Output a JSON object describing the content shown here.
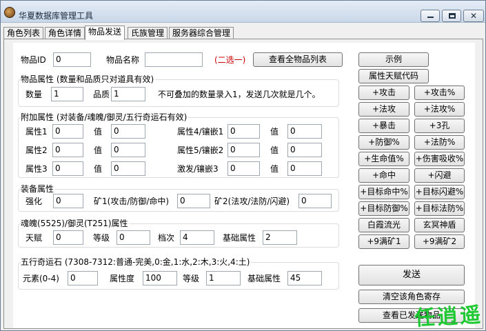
{
  "window": {
    "title": "华夏数据库管理工具",
    "close_glyph": "✕"
  },
  "tabs": [
    {
      "label": "角色列表",
      "active": false
    },
    {
      "label": "角色详情",
      "active": false
    },
    {
      "label": "物品发送",
      "active": true
    },
    {
      "label": "氏族管理",
      "active": false
    },
    {
      "label": "服务器综合管理",
      "active": false
    }
  ],
  "item": {
    "id_label": "物品ID",
    "id_value": "0",
    "name_label": "物品名称",
    "name_value": "",
    "choose_one": "(二选一)",
    "view_all_button": "查看全物品列表"
  },
  "item_attr": {
    "title": "物品属性 (数量和品质只对道具有效)",
    "qty_label": "数量",
    "qty_value": "1",
    "quality_label": "品质",
    "quality_value": "1",
    "note": "不可叠加的数量录入1，发送几次就是几个。"
  },
  "extra_attr": {
    "title": "附加属性 (对装备/魂魄/御灵/五行奇运石有效)",
    "value_label": "值",
    "rows": [
      {
        "left_label": "属性1",
        "left_attr": "0",
        "left_val": "0",
        "right_label": "属性4/镶嵌1",
        "right_attr": "0",
        "right_val": "0"
      },
      {
        "left_label": "属性2",
        "left_attr": "0",
        "left_val": "0",
        "right_label": "属性5/镶嵌2",
        "right_attr": "0",
        "right_val": "0"
      },
      {
        "left_label": "属性3",
        "left_attr": "0",
        "left_val": "0",
        "right_label": "激发/镶嵌3",
        "right_attr": "0",
        "right_val": "0"
      }
    ]
  },
  "equip_attr": {
    "title": "装备属性",
    "strengthen_label": "强化",
    "strengthen_value": "0",
    "ore1_label": "矿1(攻击/防御/命中)",
    "ore1_value": "0",
    "ore2_label": "矿2(法攻/法防/闪避)",
    "ore2_value": "0"
  },
  "soul_attr": {
    "title": "魂魄(5525)/御灵(T251)属性",
    "talent_label": "天赋",
    "talent_value": "0",
    "level_label": "等级",
    "level_value": "0",
    "grade_label": "档次",
    "grade_value": "4",
    "base_label": "基础属性",
    "base_value": "2"
  },
  "stone_attr": {
    "title": "五行奇运石 (7308-7312:普通-完美,0:金,1:水,2:木,3:火,4:土)",
    "element_label": "元素(0-4)",
    "element_value": "0",
    "attr_label": "属性度",
    "attr_value": "100",
    "level_label": "等级",
    "level_value": "1",
    "base_label": "基础属性",
    "base_value": "45"
  },
  "side_buttons": {
    "example": "示例",
    "talent_code": "属性天赋代码",
    "pairs": [
      [
        "+攻击",
        "+攻击%"
      ],
      [
        "+法攻",
        "+法攻%"
      ],
      [
        "+暴击",
        "+3孔"
      ],
      [
        "+防御%",
        "+法防%"
      ],
      [
        "+生命值%",
        "+伤害吸收%"
      ],
      [
        "+命中",
        "+闪避"
      ],
      [
        "+目标命中%",
        "+目标闪避%"
      ],
      [
        "+目标防御%",
        "+目标法防%"
      ],
      [
        "白霞流光",
        "玄冥神盾"
      ],
      [
        "+9满矿1",
        "+9满矿2"
      ]
    ],
    "send": "发送",
    "clear_storage": "清空该角色寄存",
    "view_sent": "查看已发送物品"
  },
  "watermark": "任逍遥"
}
